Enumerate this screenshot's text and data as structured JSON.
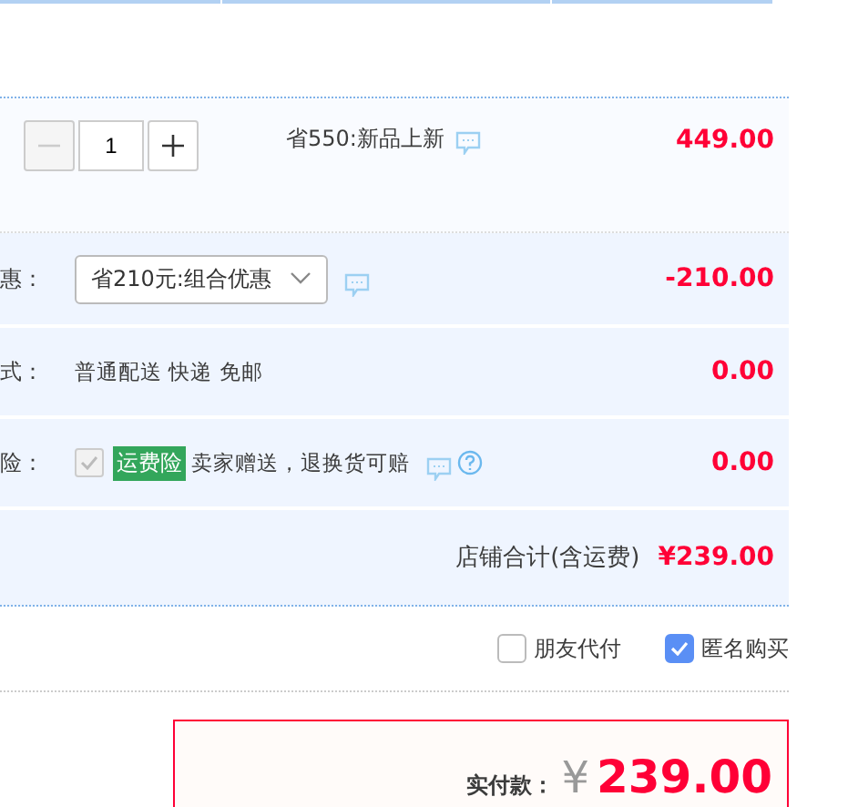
{
  "item": {
    "quantity": "1",
    "minus_disabled": true,
    "promo": "省550:新品上新",
    "price": "449.00"
  },
  "rows": [
    {
      "kind": "select",
      "label": "惠：",
      "value": "省210元:组合优惠",
      "amount": "-210.00"
    },
    {
      "kind": "text",
      "label": "式：",
      "value": "普通配送 快递 免邮",
      "amount": "0.00"
    },
    {
      "kind": "insurance",
      "label": "险：",
      "checked": true,
      "disabled": true,
      "tag": "运费险",
      "value": "卖家赠送，退换货可赔",
      "amount": "0.00"
    }
  ],
  "store_total": {
    "label": "店铺合计(含运费)",
    "value": "¥239.00"
  },
  "options": [
    {
      "label": "朋友代付",
      "checked": false
    },
    {
      "label": "匿名购买",
      "checked": true
    }
  ],
  "payment": {
    "label": "实付款：",
    "currency": "¥",
    "amount": "239.00"
  }
}
